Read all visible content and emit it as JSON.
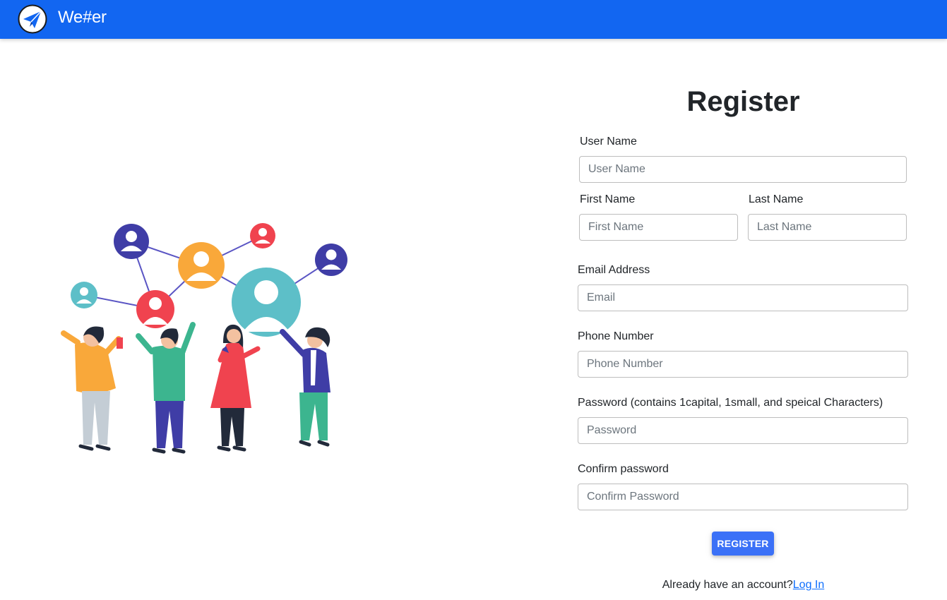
{
  "app": {
    "brand": "We#er"
  },
  "form": {
    "title": "Register",
    "username": {
      "label": "User Name",
      "placeholder": "User Name"
    },
    "first_name": {
      "label": "First Name",
      "placeholder": "First Name"
    },
    "last_name": {
      "label": "Last Name",
      "placeholder": "Last Name"
    },
    "email": {
      "label": "Email Address",
      "placeholder": "Email"
    },
    "phone": {
      "label": "Phone Number",
      "placeholder": "Phone Number"
    },
    "password": {
      "label": "Password (contains 1capital, 1small, and speical Characters)",
      "placeholder": "Password"
    },
    "confirm_password": {
      "label": "Confirm password",
      "placeholder": "Confirm Password"
    },
    "submit_label": "REGISTER",
    "login_prompt": "Already have an account?",
    "login_link": "Log In"
  },
  "colors": {
    "navbar": "#1266f1",
    "button": "#3b71f7",
    "link": "#0d6efd"
  },
  "icons": {
    "logo": "paper-plane-icon"
  }
}
